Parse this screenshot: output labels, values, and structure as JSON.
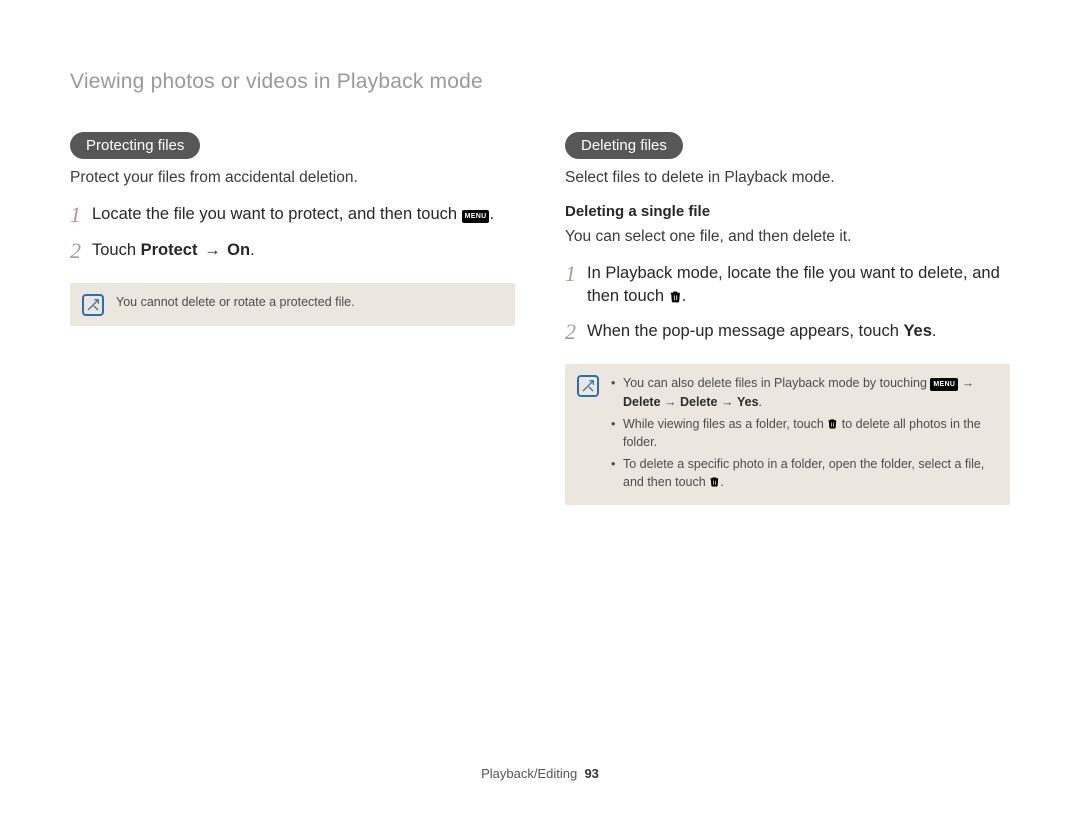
{
  "pageTitle": "Viewing photos or videos in Playback mode",
  "left": {
    "pill": "Protecting files",
    "intro": "Protect your files from accidental deletion.",
    "steps": {
      "1": {
        "pre": "Locate the file you want to protect, and then touch ",
        "menuLabel": "MENU",
        "post": "."
      },
      "2": {
        "pre": "Touch ",
        "boldA": "Protect",
        "arrow": " → ",
        "boldB": "On",
        "post": "."
      }
    },
    "note": "You cannot delete or rotate a protected file."
  },
  "right": {
    "pill": "Deleting files",
    "intro": "Select files to delete in Playback mode.",
    "subhead": "Deleting a single file",
    "subintro": "You can select one file, and then delete it.",
    "steps": {
      "1": {
        "pre": "In Playback mode, locate the file you want to delete, and then touch ",
        "post": "."
      },
      "2": {
        "pre": "When the pop-up message appears, touch ",
        "bold": "Yes",
        "post": "."
      }
    },
    "noteItems": {
      "a": {
        "pre": "You can also delete files in Playback mode by touching ",
        "menuLabel": "MENU",
        "arrow1": " → ",
        "b1": "Delete",
        "arrow2": " → ",
        "b2": "Delete",
        "arrow3": " → ",
        "b3": "Yes",
        "post": "."
      },
      "b": {
        "pre": "While viewing files as a folder, touch ",
        "post": " to delete all photos in the folder."
      },
      "c": {
        "pre": "To delete a specific photo in a folder, open the folder, select a file, and then touch ",
        "post": "."
      }
    }
  },
  "footer": {
    "section": "Playback/Editing",
    "page": "93"
  }
}
